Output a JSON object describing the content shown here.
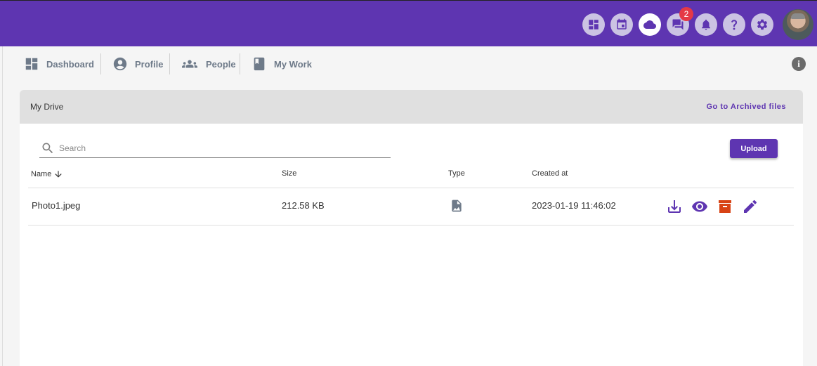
{
  "topbar": {
    "icons": [
      {
        "name": "dashboard-icon"
      },
      {
        "name": "calendar-icon"
      },
      {
        "name": "cloud-icon",
        "active": true
      },
      {
        "name": "chat-icon",
        "badge": "2"
      },
      {
        "name": "bell-icon"
      },
      {
        "name": "help-icon"
      },
      {
        "name": "gear-icon"
      }
    ],
    "chat_badge": "2"
  },
  "nav": {
    "items": [
      {
        "label": "Dashboard",
        "icon": "dashboard-icon"
      },
      {
        "label": "Profile",
        "icon": "account-circle-icon"
      },
      {
        "label": "People",
        "icon": "people-icon"
      },
      {
        "label": "My Work",
        "icon": "book-icon"
      }
    ],
    "info_glyph": "i"
  },
  "drive": {
    "title": "My Drive",
    "archived_link": "Go to Archived files",
    "search_placeholder": "Search",
    "upload_label": "Upload",
    "columns": {
      "name": "Name",
      "size": "Size",
      "type": "Type",
      "created": "Created at"
    },
    "sort": {
      "column": "name",
      "direction": "descending"
    },
    "rows": [
      {
        "name": "Photo1.jpeg",
        "size": "212.58 KB",
        "type_icon": "image-file-icon",
        "created": "2023-01-19 11:46:02",
        "actions": [
          "download-icon",
          "eye-icon",
          "archive-icon",
          "pencil-icon"
        ]
      }
    ]
  },
  "colors": {
    "brand": "#5e35b1",
    "archive": "#d84315",
    "badge": "#e53946"
  }
}
